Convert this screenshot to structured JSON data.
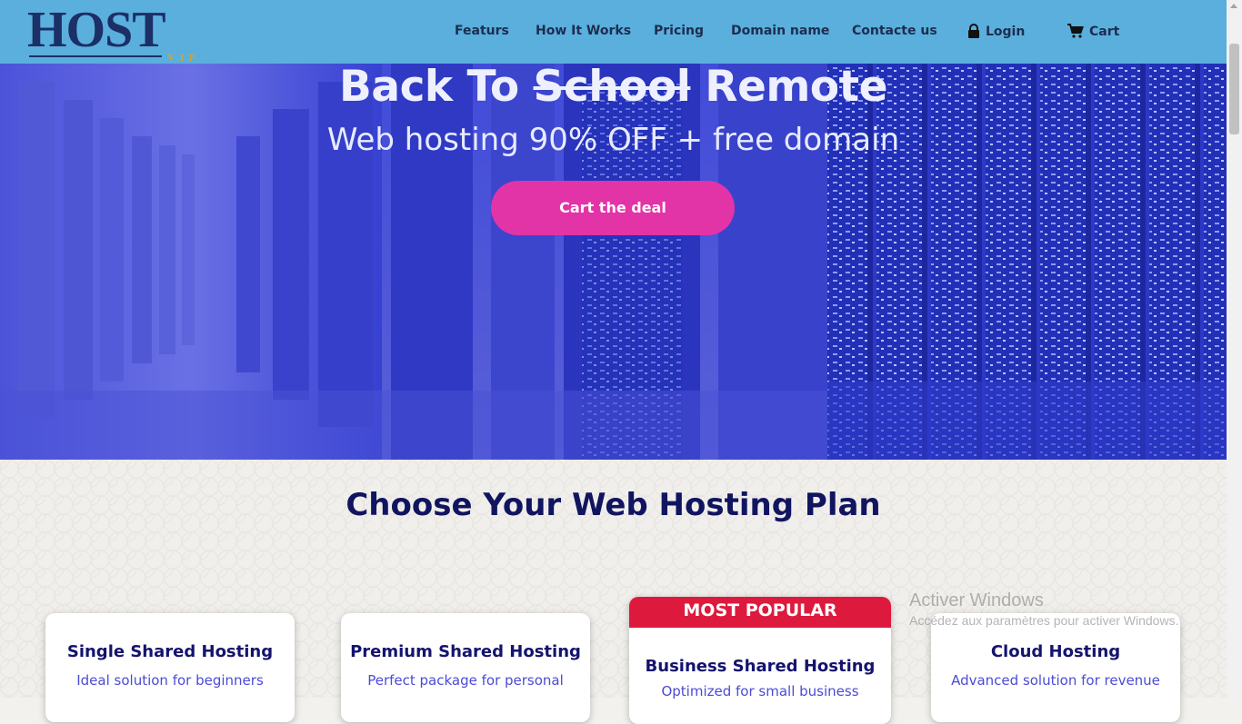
{
  "brand": {
    "name": "HOST",
    "tag": "VIP"
  },
  "nav": {
    "items": [
      "Featurs",
      "How It Works",
      "Pricing",
      "Domain name",
      "Contacte us"
    ],
    "login": "Login",
    "cart": "Cart"
  },
  "hero": {
    "title_start": "Back To ",
    "title_struck": "School",
    "title_end": " Remote",
    "subtitle": "Web hosting 90% OFF + free domain",
    "cta": "Cart the deal"
  },
  "plans": {
    "title": "Choose Your Web Hosting Plan",
    "popular_label": "MOST POPULAR",
    "cards": [
      {
        "name": "Single Shared Hosting",
        "desc": "Ideal solution for beginners"
      },
      {
        "name": "Premium Shared Hosting",
        "desc": "Perfect package for personal"
      },
      {
        "name": "Business Shared Hosting",
        "desc": "Optimized for small business"
      },
      {
        "name": "Cloud Hosting",
        "desc": "Advanced solution for revenue"
      }
    ]
  },
  "watermark": {
    "line1": "Activer Windows",
    "line2": "Accédez aux paramètres pour activer Windows."
  },
  "colors": {
    "header": "#5aafdd",
    "hero_overlay": "#3a46d6",
    "cta": "#e234a6",
    "popular": "#dd1a3d",
    "heading": "#111560"
  }
}
